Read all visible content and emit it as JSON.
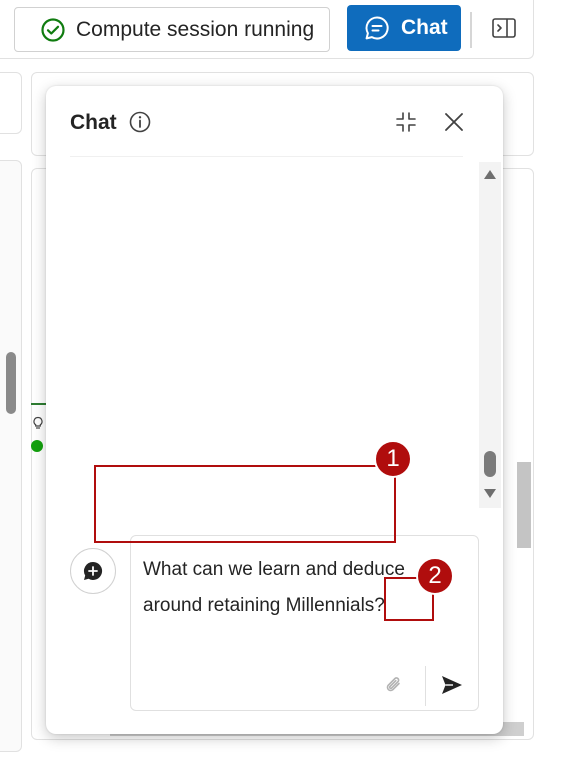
{
  "toolbar": {
    "session_status": "Compute session running",
    "chat_label": "Chat",
    "icons": {
      "session": "check-circle-icon",
      "chat": "chat-bubble-icon",
      "panel": "panel-toggle-icon"
    },
    "colors": {
      "chat_button_bg": "#0f6cbd",
      "session_check": "#107c10"
    }
  },
  "chat_panel": {
    "title": "Chat",
    "icons": {
      "info": "info-icon",
      "collapse": "collapse-icon",
      "close": "close-icon",
      "new_chat": "new-chat-icon",
      "attach": "paperclip-icon",
      "send": "send-icon"
    },
    "input": {
      "value": "What can we learn and deduce around retaining Millennials?"
    }
  },
  "annotations": {
    "step_1": "1",
    "step_2": "2",
    "color": "#b00d0d"
  }
}
